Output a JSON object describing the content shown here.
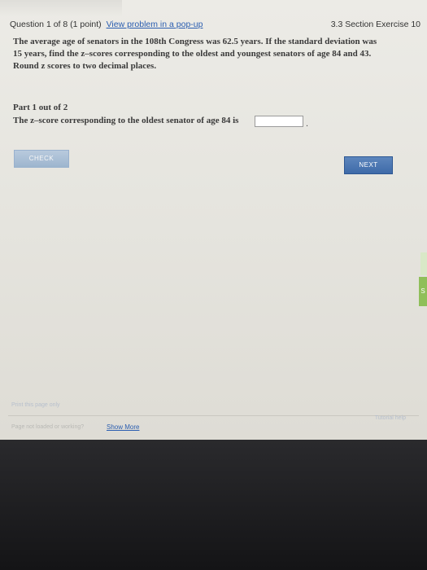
{
  "header": {
    "question_info": "Question 1 of 8 (1 point)",
    "popup_link": "View problem in a pop-up",
    "section": "3.3 Section Exercise 10"
  },
  "problem": {
    "line1": "The average age of senators in the 108th Congress was 62.5 years. If the standard deviation was",
    "line2": "15 years, find the z–scores corresponding to the oldest and youngest senators of age 84 and 43.",
    "line3": "Round z scores to two decimal places."
  },
  "part": {
    "label": "Part 1 out of 2",
    "prompt": "The z–score corresponding to the oldest senator of age 84 is",
    "answer_value": "",
    "suffix": "."
  },
  "buttons": {
    "check": "CHECK",
    "next": "NEXT"
  },
  "footer": {
    "print": "Print this page only",
    "not_working": "Page not loaded or working?",
    "show_more": "Show More",
    "tutorial": "Tutorial help"
  },
  "side_tab": {
    "label": "S"
  }
}
